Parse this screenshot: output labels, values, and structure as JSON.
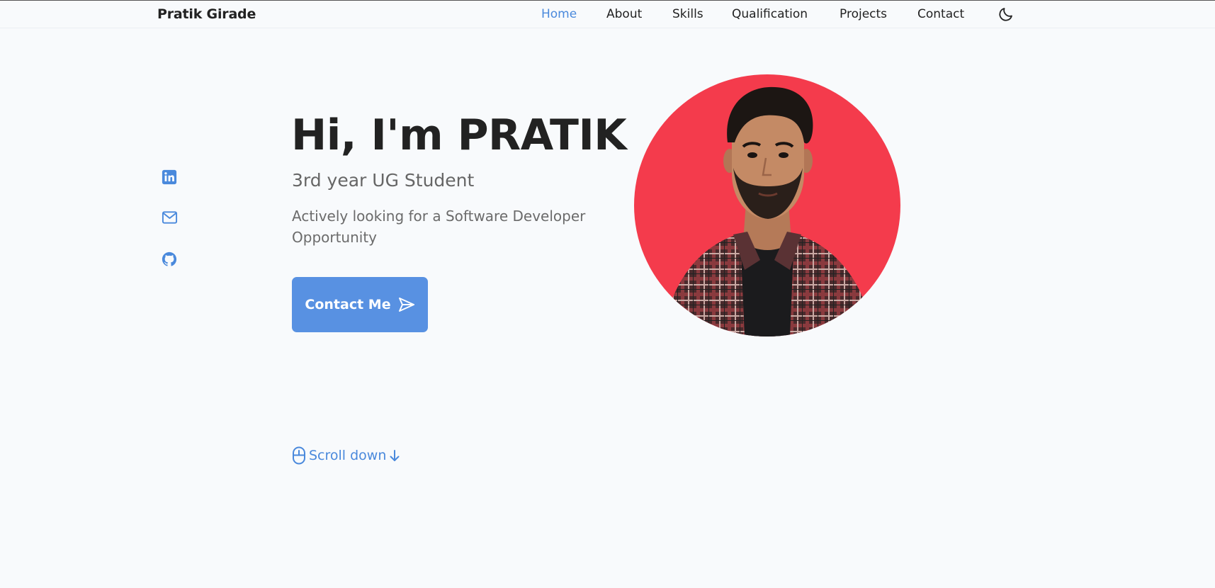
{
  "header": {
    "logo": "Pratik Girade",
    "nav": [
      {
        "label": "Home",
        "active": true
      },
      {
        "label": "About",
        "active": false
      },
      {
        "label": "Skills",
        "active": false
      },
      {
        "label": "Qualification",
        "active": false
      },
      {
        "label": "Projects",
        "active": false
      },
      {
        "label": "Contact",
        "active": false
      }
    ],
    "theme_toggle_icon": "moon-icon"
  },
  "social": [
    {
      "name": "linkedin-icon"
    },
    {
      "name": "mail-icon"
    },
    {
      "name": "github-icon"
    }
  ],
  "hero": {
    "title": "Hi, I'm PRATIK",
    "subtitle": "3rd year UG Student",
    "description": "Actively looking for a Software Developer Opportunity",
    "cta_label": "Contact Me",
    "cta_icon": "send-icon",
    "scroll_label": "Scroll down",
    "scroll_icons": [
      "mouse-icon",
      "arrow-down-icon"
    ],
    "avatar_icon": "profile-photo"
  },
  "colors": {
    "accent": "#4a89dc",
    "button": "#5891e2",
    "avatar_bg": "#f43b4c",
    "background": "#f8fafc"
  }
}
